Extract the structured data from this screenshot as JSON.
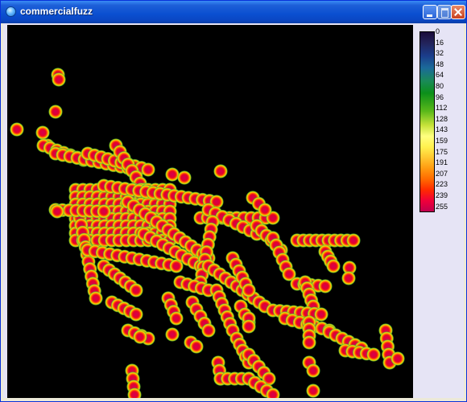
{
  "window": {
    "title": "commercialfuzz",
    "icon": "globe-icon"
  },
  "legend": {
    "labels": [
      "0",
      "16",
      "32",
      "48",
      "64",
      "80",
      "96",
      "112",
      "128",
      "143",
      "159",
      "175",
      "191",
      "207",
      "223",
      "239",
      "255"
    ]
  },
  "colors": {
    "hot": "#d4004e",
    "warm": "#ff3a00",
    "mid": "#ffd400",
    "cool": "#8fd32a",
    "edge": "#1d7a3a"
  }
}
